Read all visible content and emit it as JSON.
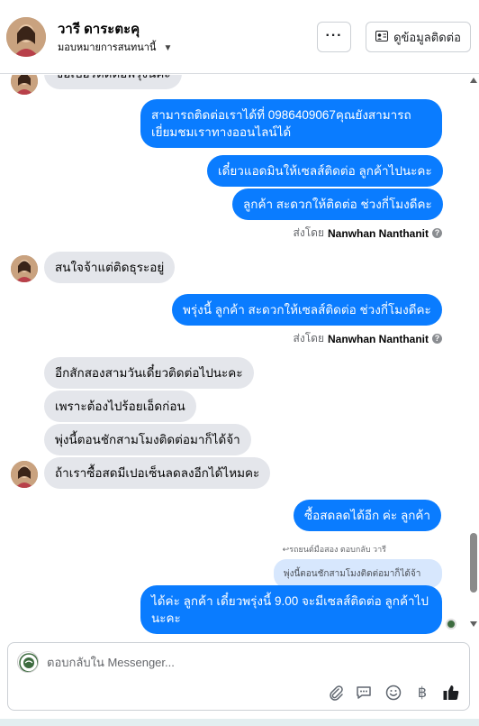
{
  "header": {
    "contact_name": "วารี ดาระตะคุ",
    "assign_label": "มอบหมายการสนทนานี้",
    "more_label": "···",
    "contact_info_label": "ดูข้อมูลติดต่อ"
  },
  "thread": {
    "cut_off_message": "ขอเบอร์ติดต่อพรุ่งนี้ค่ะ",
    "messages": [
      {
        "id": "m1",
        "direction": "out",
        "text": "สามารถติดต่อเราได้ที่ 0986409067คุณยังสามารถเยี่ยมชมเราทางออนไลน์ได้"
      },
      {
        "id": "m2",
        "direction": "out",
        "text": "เดี๋ยวแอดมินให้เซลส์ติดต่อ ลูกค้าไปนะคะ"
      },
      {
        "id": "m3",
        "direction": "out",
        "text": "ลูกค้า สะดวกให้ติดต่อ ช่วงกี่โมงดีคะ"
      },
      {
        "id": "m4",
        "direction": "in",
        "text": "สนใจจ้าแต่ติดธุระอยู่"
      },
      {
        "id": "m5",
        "direction": "out",
        "text": "พรุ่งนี้ ลูกค้า สะดวกให้เซลส์ติดต่อ ช่วงกี่โมงดีคะ"
      },
      {
        "id": "m6",
        "direction": "in",
        "text": "อีกสักสองสามวันเดี๋ยวติดต่อไปนะคะ"
      },
      {
        "id": "m7",
        "direction": "in",
        "text": "เพราะต้องไปร้อยเอ็ดก่อน"
      },
      {
        "id": "m8",
        "direction": "in",
        "text": "พุ่งนี้ตอนชักสามโมงติดต่อมาก็ได้จ้า"
      },
      {
        "id": "m9",
        "direction": "in",
        "text": "ถ้าเราซื้อสดมีเปอเซ็นลดลงอีกได้ไหมคะ"
      },
      {
        "id": "m10",
        "direction": "out",
        "text": "ซื้อสดลดได้อีก ค่ะ ลูกค้า"
      },
      {
        "id": "m11",
        "direction": "out",
        "text": "ได้ค่ะ ลูกค้า เดี๋ยวพรุ่งนี้ 9.00 จะมีเซลส์ติดต่อ ลูกค้าไปนะคะ"
      }
    ],
    "sent_by_prefix": "ส่งโดย",
    "sent_by_name": "Nanwhan Nanthanit",
    "reply_meta": "รถยนต์มือสอง ตอบกลับ วารี",
    "reply_quote": "พุ่งนี้ตอนชักสามโมงติดต่อมาก็ได้จ้า"
  },
  "composer": {
    "placeholder": "ตอบกลับใน Messenger..."
  },
  "colors": {
    "outgoing_bubble": "#0a7cff",
    "incoming_bubble": "#e4e6eb",
    "reply_quote_bg": "#d7e7fd"
  },
  "icons": [
    "chevron-down-icon",
    "contact-card-icon",
    "info-icon",
    "paperclip-icon",
    "chat-bubble-icon",
    "emoji-icon",
    "baht-icon",
    "thumbs-up-icon"
  ]
}
